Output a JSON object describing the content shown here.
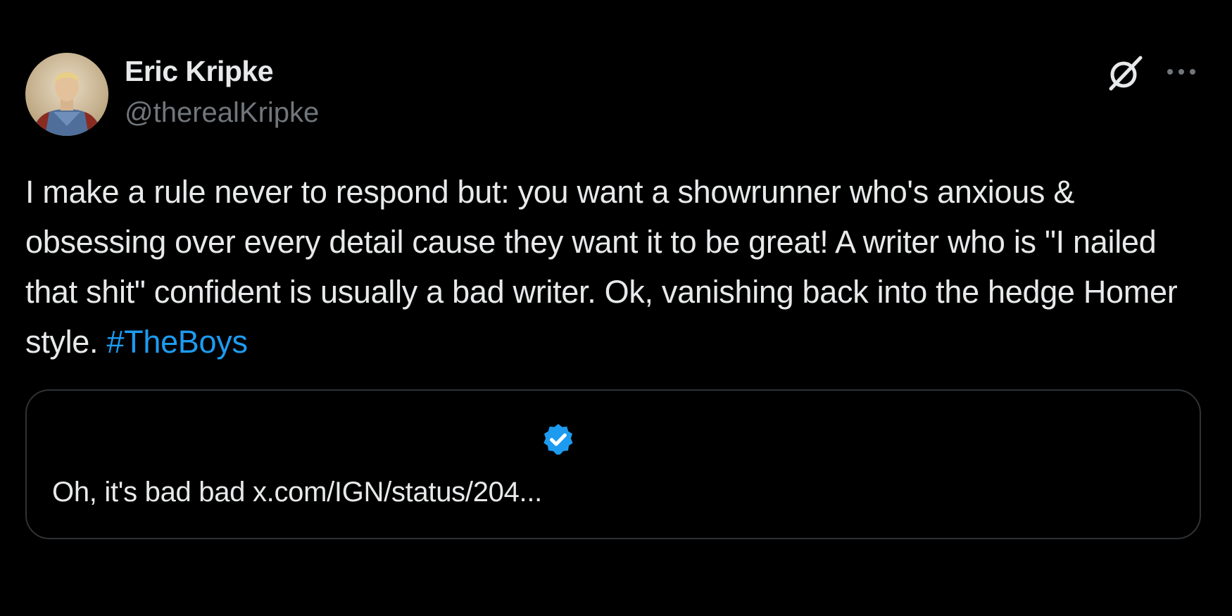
{
  "author": {
    "display_name": "Eric Kripke",
    "handle": "@therealKripke",
    "avatar_icon": "avatar-portrait"
  },
  "header_actions": {
    "grok_icon": "grok-icon",
    "more_icon": "more-options-icon"
  },
  "tweet": {
    "text": "I make a rule never to respond but: you want a showrunner who's anxious & obsessing over every detail cause they want it to be great! A writer who is \"I nailed that shit\" confident is usually a bad writer. Ok, vanishing back into the hedge Homer style. ",
    "hashtag": "#TheBoys"
  },
  "quote": {
    "verified_icon": "verified-badge-icon",
    "text": "Oh, it's bad bad x.com/IGN/status/204..."
  },
  "colors": {
    "background": "#000000",
    "text_primary": "#e7e9ea",
    "text_secondary": "#71767b",
    "accent": "#1d9bf0",
    "border": "#2f3336"
  }
}
